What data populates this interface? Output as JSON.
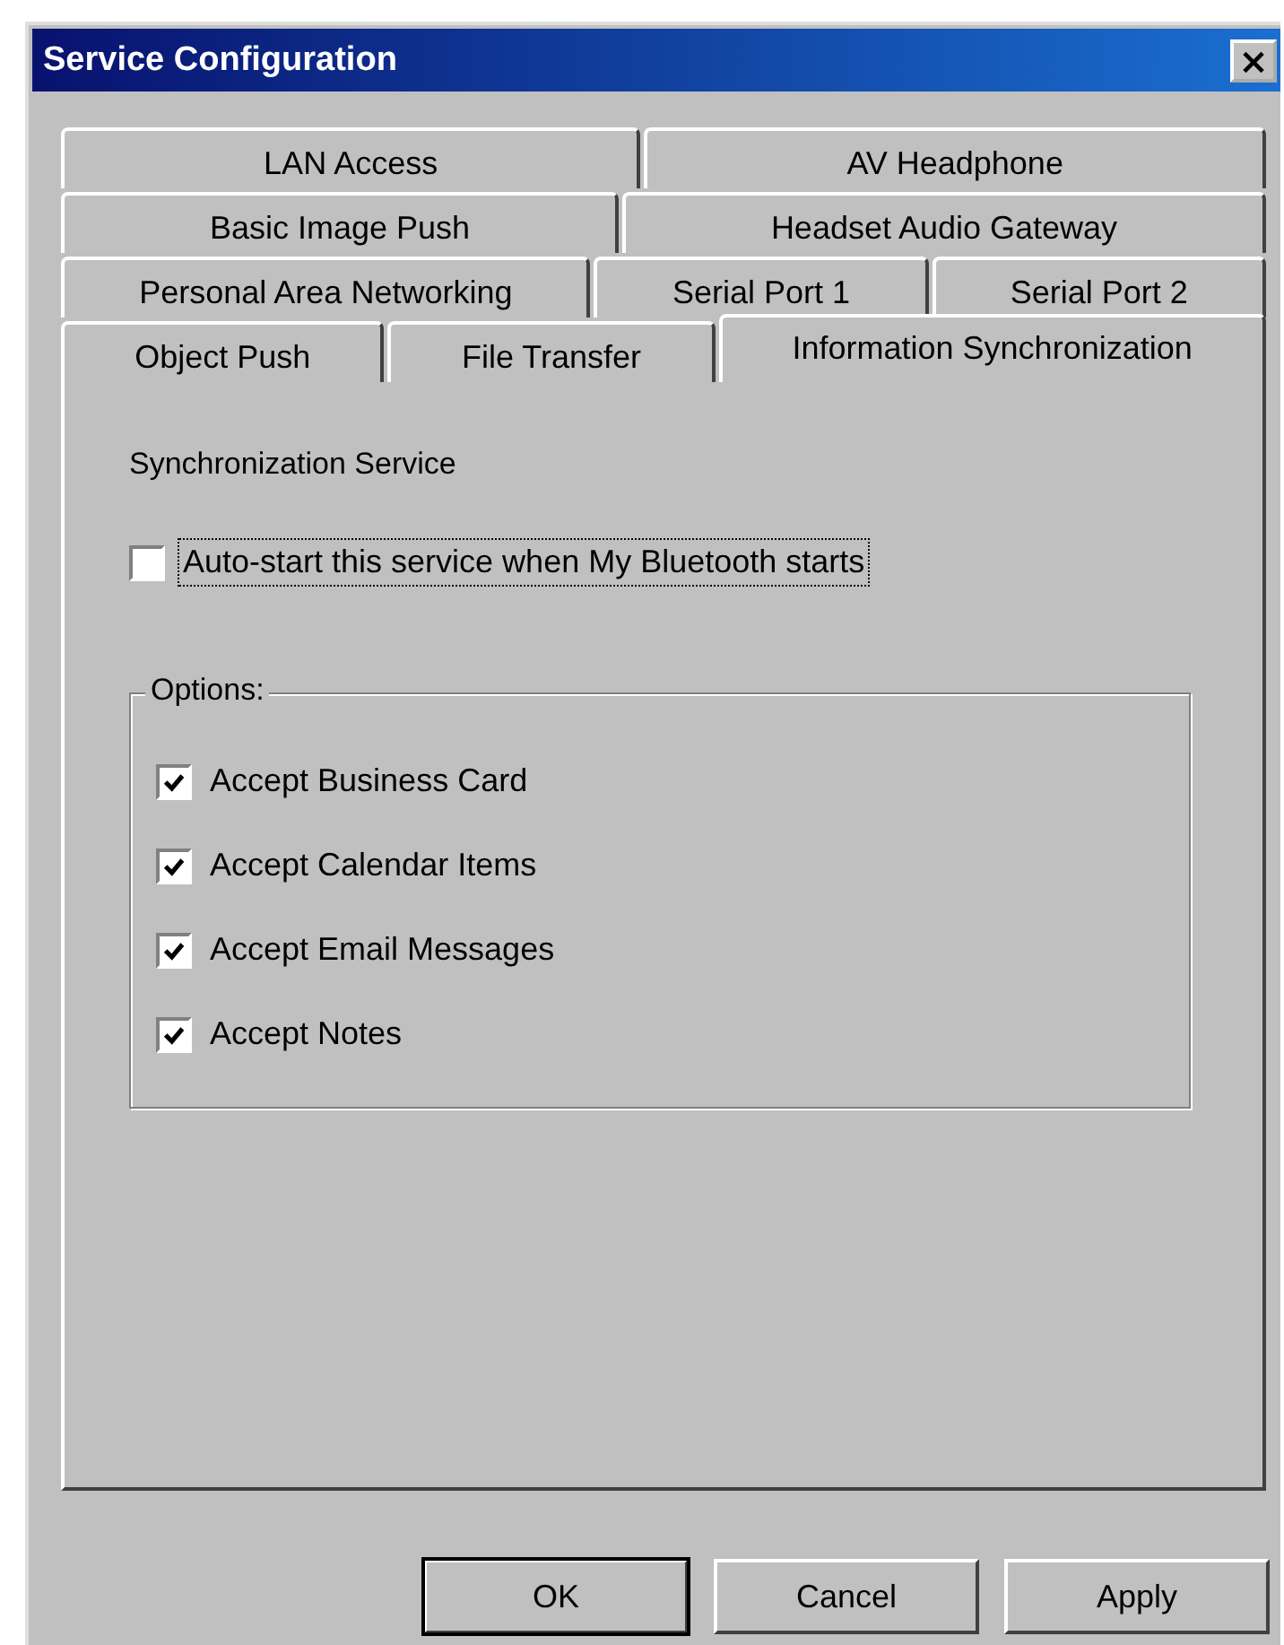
{
  "window": {
    "title": "Service Configuration",
    "close": "×"
  },
  "tab_rows": [
    {
      "tabs": [
        {
          "label": "LAN Access",
          "selected": false
        },
        {
          "label": "AV Headphone",
          "selected": false
        }
      ]
    },
    {
      "tabs": [
        {
          "label": "Basic Image Push",
          "selected": false
        },
        {
          "label": "Headset Audio Gateway",
          "selected": false
        }
      ]
    },
    {
      "tabs": [
        {
          "label": "Personal Area Networking",
          "selected": false
        },
        {
          "label": "Serial Port 1",
          "selected": false
        },
        {
          "label": "Serial Port 2",
          "selected": false
        }
      ]
    },
    {
      "tabs": [
        {
          "label": "Object Push",
          "selected": false
        },
        {
          "label": "File Transfer",
          "selected": false
        },
        {
          "label": "Information Synchronization",
          "selected": true
        }
      ]
    }
  ],
  "section_title": "Synchronization Service",
  "auto_start": {
    "label": "Auto-start this service when My Bluetooth starts",
    "checked": false
  },
  "options": {
    "title": "Options:",
    "items": [
      {
        "label": "Accept Business Card",
        "checked": true
      },
      {
        "label": "Accept Calendar Items",
        "checked": true
      },
      {
        "label": "Accept Email Messages",
        "checked": true
      },
      {
        "label": "Accept Notes",
        "checked": true
      }
    ]
  },
  "buttons": [
    {
      "label": "OK",
      "default": true
    },
    {
      "label": "Cancel",
      "default": false
    },
    {
      "label": "Apply",
      "default": false
    }
  ]
}
